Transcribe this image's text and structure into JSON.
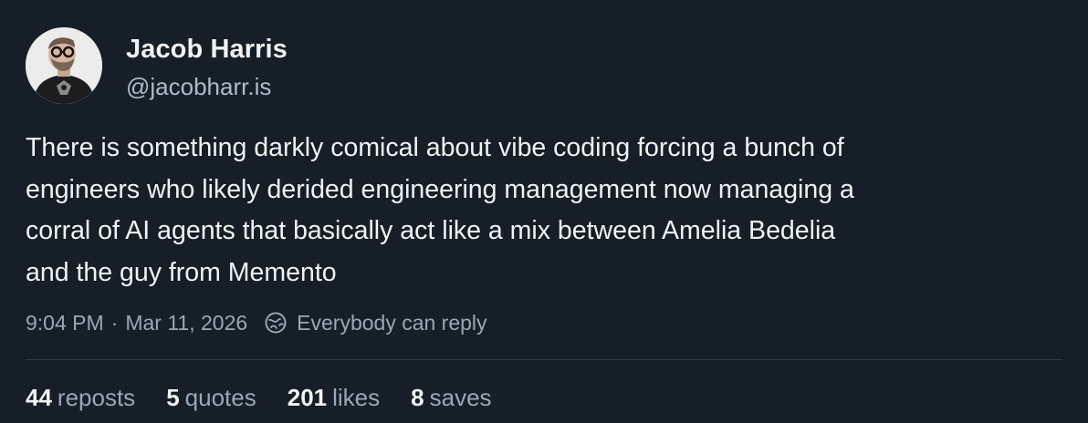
{
  "author": {
    "display_name": "Jacob Harris",
    "handle": "@jacobharr.is",
    "avatar_icon": "avatar-photo"
  },
  "post": {
    "text": "There is something darkly comical about vibe coding forcing a bunch of\nengineers who likely derided engineering management now managing a\ncorral of AI agents that basically act like a mix between Amelia Bedelia\nand the guy from Memento"
  },
  "meta": {
    "time": "9:04 PM",
    "separator": "·",
    "date": "Mar 11, 2026",
    "reply_setting": "Everybody can reply",
    "reply_icon": "globe-icon"
  },
  "stats": {
    "reposts": {
      "count": "44",
      "label": "reposts"
    },
    "quotes": {
      "count": "5",
      "label": "quotes"
    },
    "likes": {
      "count": "201",
      "label": "likes"
    },
    "saves": {
      "count": "8",
      "label": "saves"
    }
  },
  "colors": {
    "background": "#161e27",
    "text": "#f1f3f5",
    "muted": "#9aa8b6",
    "divider": "#2d3947"
  }
}
